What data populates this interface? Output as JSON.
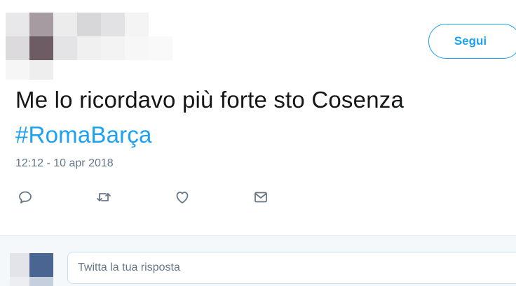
{
  "header": {
    "follow_label": "Segui"
  },
  "tweet": {
    "text": "Me lo ricordavo più forte sto Cosenza",
    "hashtag": "#RomaBarça",
    "timestamp": "12:12 - 10 apr 2018"
  },
  "actions": [
    {
      "name": "reply",
      "icon": "reply-icon"
    },
    {
      "name": "retweet",
      "icon": "retweet-icon"
    },
    {
      "name": "like",
      "icon": "heart-icon"
    },
    {
      "name": "direct-message",
      "icon": "mail-icon"
    }
  ],
  "reply_box": {
    "placeholder": "Twitta la tua risposta"
  },
  "colors": {
    "accent": "#1da1f2",
    "text": "#14171a",
    "muted": "#657786"
  }
}
